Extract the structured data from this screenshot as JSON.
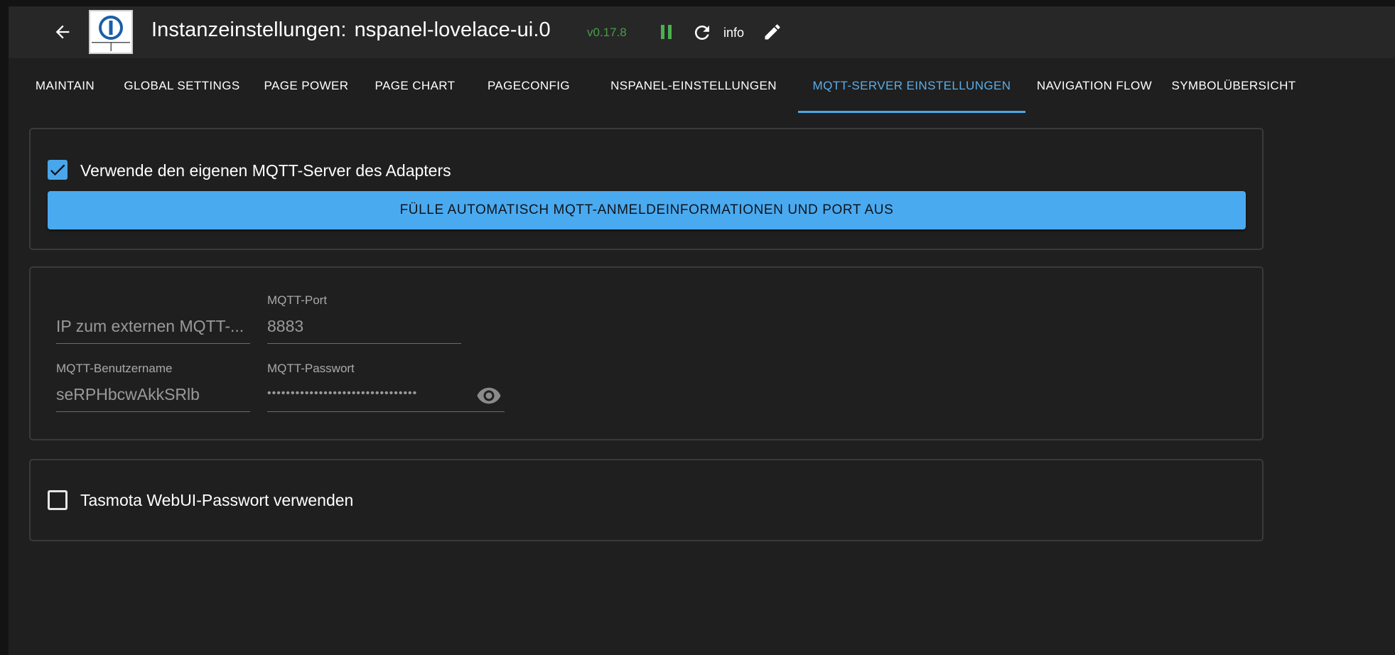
{
  "header": {
    "title_prefix": "Instanzeinstellungen:",
    "title_instance": "nspanel-lovelace-ui.0",
    "version": "v0.17.8",
    "info_label": "info",
    "icons": {
      "back": "arrow-left-icon",
      "logo": "iobroker-logo",
      "pause": "pause-icon",
      "reload": "reload-icon",
      "edit": "pencil-icon"
    }
  },
  "tabs": [
    {
      "label": "MAINTAIN",
      "active": false
    },
    {
      "label": "GLOBAL SETTINGS",
      "active": false
    },
    {
      "label": "PAGE POWER",
      "active": false
    },
    {
      "label": "PAGE CHART",
      "active": false
    },
    {
      "label": "PAGECONFIG",
      "active": false
    },
    {
      "label": "NSPANEL-EINSTELLUNGEN",
      "active": false
    },
    {
      "label": "MQTT-SERVER EINSTELLUNGEN",
      "active": true
    },
    {
      "label": "NAVIGATION FLOW",
      "active": false
    },
    {
      "label": "SYMBOLÜBERSICHT",
      "active": false
    }
  ],
  "mqtt_own_server": {
    "checkbox_label": "Verwende den eigenen MQTT-Server des Adapters",
    "checked": true,
    "fill_button_label": "FÜLLE AUTOMATISCH MQTT-ANMELDEINFORMATIONEN UND PORT AUS"
  },
  "mqtt_fields": {
    "ip": {
      "label": "",
      "value": "",
      "placeholder": "IP zum externen MQTT-..."
    },
    "port": {
      "label": "MQTT-Port",
      "value": "8883"
    },
    "username": {
      "label": "MQTT-Benutzername",
      "value": "seRPHbcwAkkSRlb"
    },
    "password": {
      "label": "MQTT-Passwort",
      "value": "••••••••••••••••••••••••••••••••",
      "toggle_icon": "eye-icon"
    }
  },
  "tasmota": {
    "checkbox_label": "Tasmota WebUI-Passwort verwenden",
    "checked": false
  },
  "colors": {
    "accent": "#4aa6ea",
    "version": "#4a9a4c",
    "pause": "#4caf50",
    "background": "#1f1f1f",
    "header": "#272727"
  }
}
